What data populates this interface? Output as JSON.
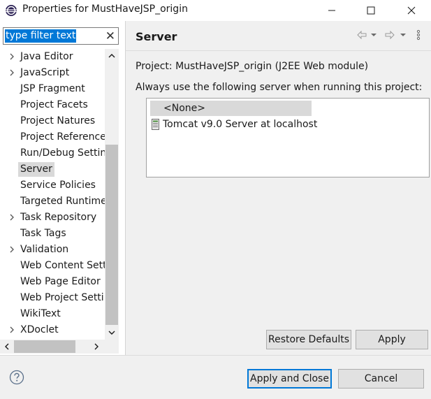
{
  "window": {
    "title": "Properties for MustHaveJSP_origin"
  },
  "filter": {
    "value": "type filter text",
    "clear_icon": "close-icon"
  },
  "tree": {
    "items": [
      {
        "label": "Java Editor",
        "expandable": true,
        "selected": false
      },
      {
        "label": "JavaScript",
        "expandable": true,
        "selected": false
      },
      {
        "label": "JSP Fragment",
        "expandable": false,
        "selected": false
      },
      {
        "label": "Project Facets",
        "expandable": false,
        "selected": false
      },
      {
        "label": "Project Natures",
        "expandable": false,
        "selected": false
      },
      {
        "label": "Project References",
        "expandable": false,
        "selected": false
      },
      {
        "label": "Run/Debug Settings",
        "expandable": false,
        "selected": false
      },
      {
        "label": "Server",
        "expandable": false,
        "selected": true
      },
      {
        "label": "Service Policies",
        "expandable": false,
        "selected": false
      },
      {
        "label": "Targeted Runtimes",
        "expandable": false,
        "selected": false
      },
      {
        "label": "Task Repository",
        "expandable": true,
        "selected": false
      },
      {
        "label": "Task Tags",
        "expandable": false,
        "selected": false
      },
      {
        "label": "Validation",
        "expandable": true,
        "selected": false
      },
      {
        "label": "Web Content Settings",
        "expandable": false,
        "selected": false
      },
      {
        "label": "Web Page Editor",
        "expandable": false,
        "selected": false
      },
      {
        "label": "Web Project Settings",
        "expandable": false,
        "selected": false
      },
      {
        "label": "WikiText",
        "expandable": false,
        "selected": false
      },
      {
        "label": "XDoclet",
        "expandable": true,
        "selected": false
      }
    ]
  },
  "page": {
    "title": "Server",
    "project_line": "Project: MustHaveJSP_origin (J2EE Web module)",
    "always_line": "Always use the following server when running this project:",
    "servers": [
      {
        "label": "<None>",
        "selected": true
      },
      {
        "label": "Tomcat v9.0 Server at localhost",
        "selected": false,
        "icon": "tomcat-server-icon"
      }
    ],
    "restore_defaults_label": "Restore Defaults",
    "apply_label": "Apply"
  },
  "footer": {
    "apply_close_label": "Apply and Close",
    "cancel_label": "Cancel"
  },
  "colors": {
    "selection_blue": "#0078d7",
    "selection_gray": "#d9d9d9",
    "panel_bg": "#f0f0f0"
  }
}
